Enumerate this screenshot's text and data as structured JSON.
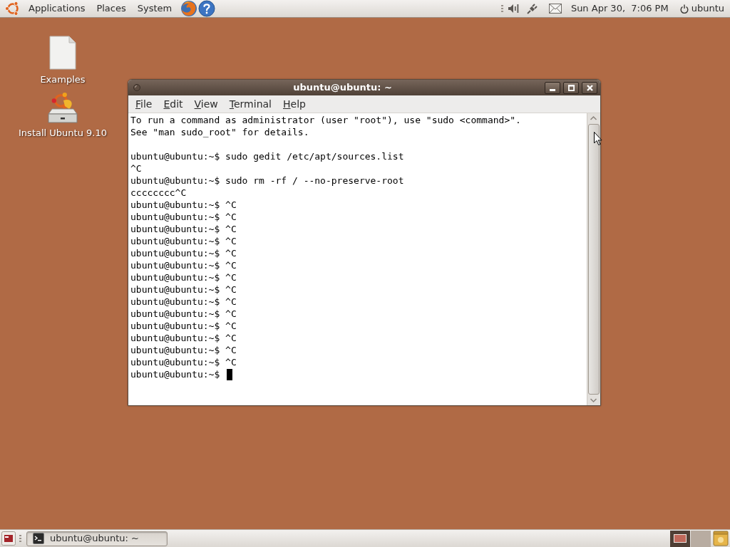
{
  "top_panel": {
    "menus": [
      "Applications",
      "Places",
      "System"
    ],
    "clock": "Sun Apr 30,  7:06 PM",
    "user": "ubuntu"
  },
  "desktop_icons": [
    {
      "kind": "document",
      "label": "Examples"
    },
    {
      "kind": "installer",
      "label": "Install Ubuntu 9.10"
    }
  ],
  "window": {
    "title": "ubuntu@ubuntu: ~",
    "menu": [
      "File",
      "Edit",
      "View",
      "Terminal",
      "Help"
    ],
    "output_blocks": [
      [
        "To run a command as administrator (user \"root\"), use \"sudo <command>\".",
        "See \"man sudo_root\" for details."
      ],
      [
        "ubuntu@ubuntu:~$ sudo gedit /etc/apt/sources.list",
        "^C",
        "ubuntu@ubuntu:~$ sudo rm -rf / --no-preserve-root",
        "cccccccc^C",
        "ubuntu@ubuntu:~$ ^C",
        "ubuntu@ubuntu:~$ ^C",
        "ubuntu@ubuntu:~$ ^C",
        "ubuntu@ubuntu:~$ ^C",
        "ubuntu@ubuntu:~$ ^C",
        "ubuntu@ubuntu:~$ ^C",
        "ubuntu@ubuntu:~$ ^C",
        "ubuntu@ubuntu:~$ ^C",
        "ubuntu@ubuntu:~$ ^C",
        "ubuntu@ubuntu:~$ ^C",
        "ubuntu@ubuntu:~$ ^C",
        "ubuntu@ubuntu:~$ ^C",
        "ubuntu@ubuntu:~$ ^C",
        "ubuntu@ubuntu:~$ ^C"
      ]
    ],
    "prompt": "ubuntu@ubuntu:~$"
  },
  "bottom_panel": {
    "tasks": [
      {
        "label": "ubuntu@ubuntu: ~",
        "selected": true
      }
    ],
    "workspaces": [
      {
        "selected": true
      },
      {
        "selected": false
      }
    ]
  }
}
